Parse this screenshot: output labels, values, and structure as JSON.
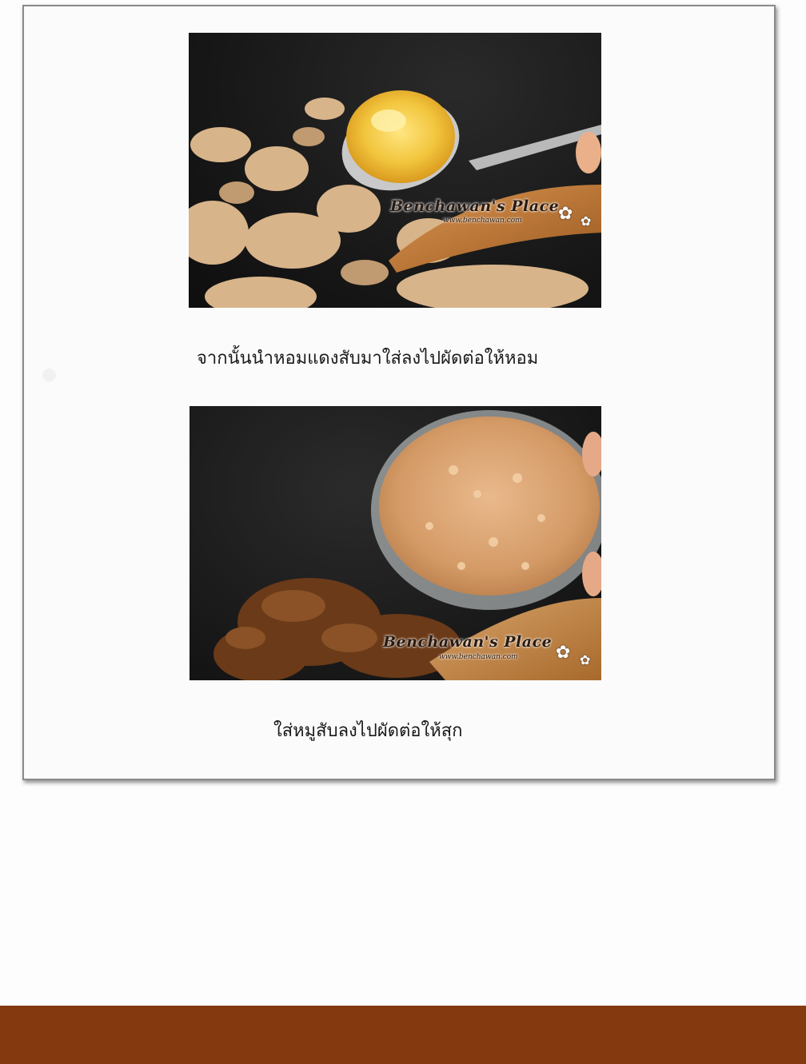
{
  "post": {
    "step1": {
      "watermark_title": "Benchawan's Place",
      "watermark_url": "www.benchawan.com",
      "caption": "จากนั้นนำหอมแดงสับมาใส่ลงไปผัดต่อให้หอม"
    },
    "step2": {
      "watermark_title": "Benchawan's Place",
      "watermark_url": "www.benchawan.com",
      "caption": "ใส่หมูสับลงไปผัดต่อให้สุก"
    }
  },
  "colors": {
    "footer": "#843a0e",
    "card_border": "#8a8a8a"
  }
}
